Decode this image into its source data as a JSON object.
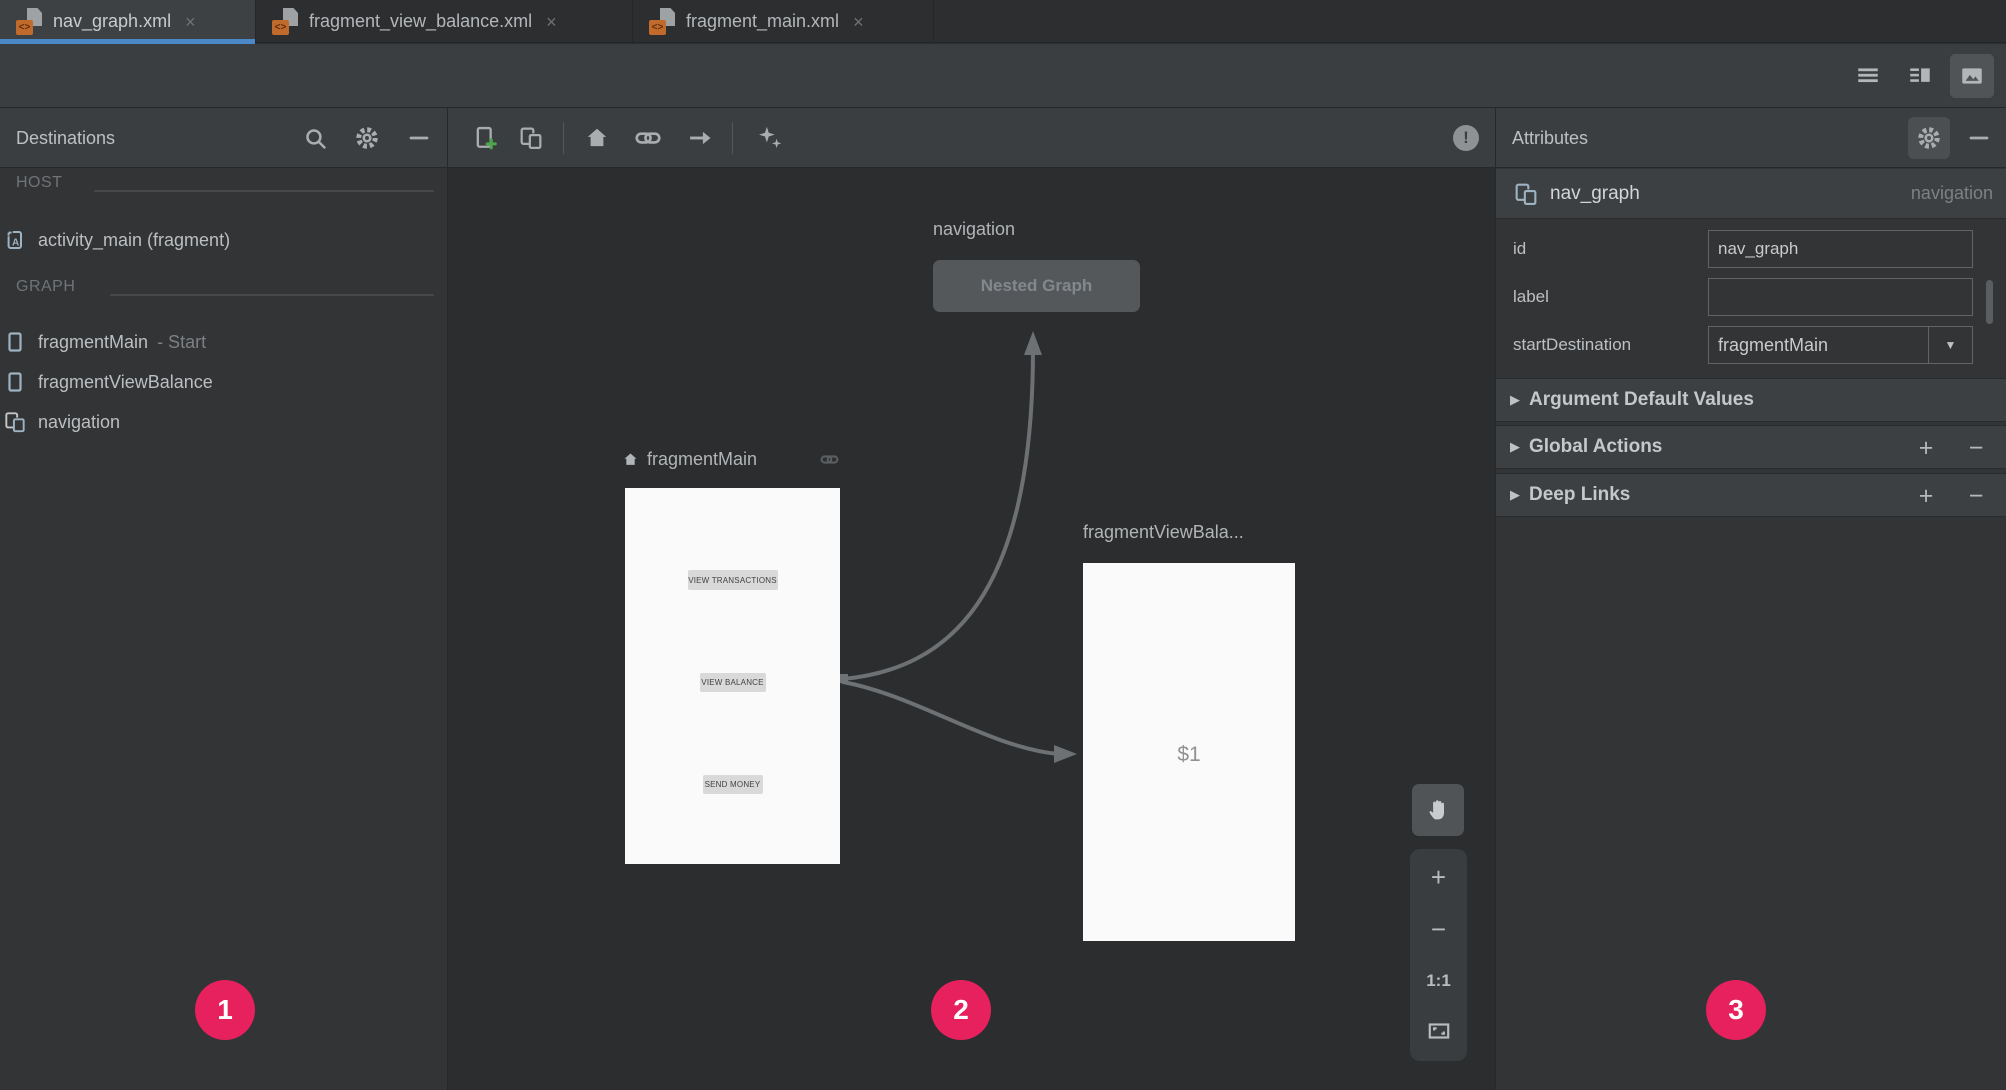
{
  "ui": {
    "close": "×",
    "plus": "+",
    "minus": "−",
    "expand": "▶",
    "dropdown": "▼",
    "warning": "!",
    "xml_glyph": "<>"
  },
  "tabs": {
    "items": [
      {
        "label": "nav_graph.xml",
        "active": true
      },
      {
        "label": "fragment_view_balance.xml",
        "active": false
      },
      {
        "label": "fragment_main.xml",
        "active": false
      }
    ]
  },
  "destinations": {
    "title": "Destinations",
    "host_section_label": "HOST",
    "graph_section_label": "GRAPH",
    "host_item": {
      "label": "activity_main (fragment)"
    },
    "graph_items": [
      {
        "label": "fragmentMain",
        "suffix": "- Start"
      },
      {
        "label": "fragmentViewBalance",
        "suffix": ""
      },
      {
        "label": "navigation",
        "suffix": ""
      }
    ]
  },
  "canvas": {
    "nested_node": {
      "title": "navigation",
      "button_label": "Nested Graph"
    },
    "main_node": {
      "title": "fragmentMain",
      "buttons": [
        "VIEW TRANSACTIONS",
        "VIEW BALANCE",
        "SEND MONEY"
      ]
    },
    "balance_node": {
      "title": "fragmentViewBala...",
      "content": "$1"
    },
    "zoom_controls": {
      "ratio": "1:1"
    }
  },
  "attributes": {
    "title": "Attributes",
    "component": {
      "name": "nav_graph",
      "type": "navigation"
    },
    "fields": [
      {
        "label": "id",
        "value": "nav_graph"
      },
      {
        "label": "label",
        "value": ""
      },
      {
        "label": "startDestination",
        "value": "fragmentMain"
      }
    ],
    "sections": [
      {
        "label": "Argument Default Values"
      },
      {
        "label": "Global Actions"
      },
      {
        "label": "Deep Links"
      }
    ]
  },
  "badges": [
    {
      "number": "1"
    },
    {
      "number": "2"
    },
    {
      "number": "3"
    }
  ],
  "colors": {
    "badge_pink": "#E6215E",
    "tab_underline": "#4A88C7",
    "canvas_bg": "#2b2d2e",
    "panel_bg": "#323436",
    "bar_bg": "#3b3e40",
    "xml_icon_orange": "#c06a2c",
    "add_plus_green": "#4CA64C"
  }
}
